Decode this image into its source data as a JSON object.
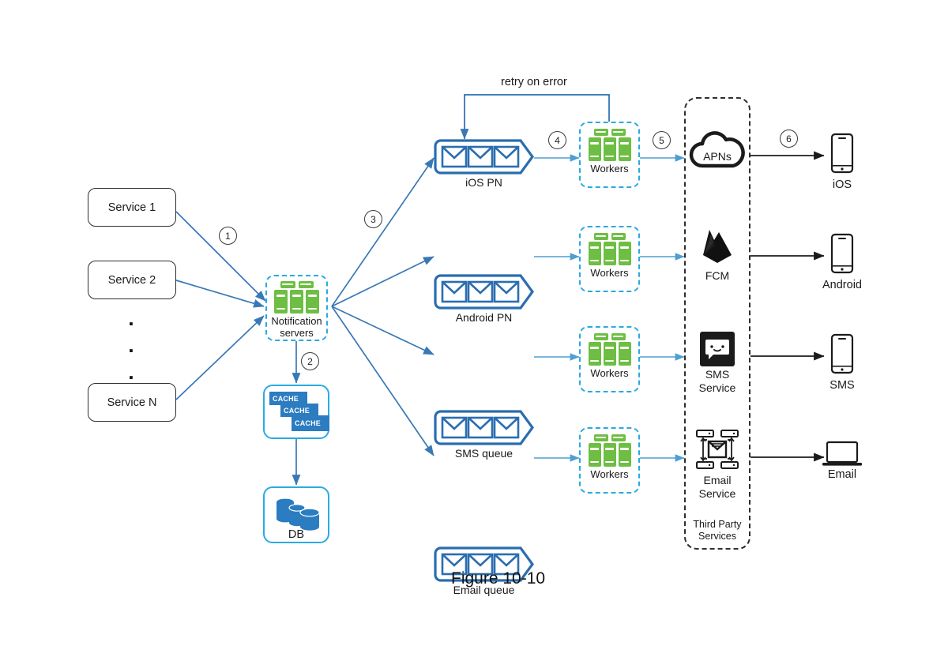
{
  "figure": {
    "caption": "Figure 10-10"
  },
  "services": {
    "items": [
      {
        "label": "Service 1"
      },
      {
        "label": "Service 2"
      },
      {
        "label": "Service N"
      }
    ],
    "ellipsis": "."
  },
  "notification_servers": {
    "line1": "Notification",
    "line2": "servers",
    "icon": "server-rack-icon"
  },
  "storage": {
    "cache": {
      "chips": [
        "CACHE",
        "CACHE",
        "CACHE"
      ],
      "icon": "cache-icon"
    },
    "db": {
      "label": "DB",
      "icon": "database-icon"
    }
  },
  "queues": [
    {
      "label": "iOS PN"
    },
    {
      "label": "Android PN"
    },
    {
      "label": "SMS queue"
    },
    {
      "label": "Email queue"
    }
  ],
  "workers": [
    {
      "label": "Workers"
    },
    {
      "label": "Workers"
    },
    {
      "label": "Workers"
    },
    {
      "label": "Workers"
    }
  ],
  "third_party": {
    "container_label_line1": "Third Party",
    "container_label_line2": "Services",
    "items": [
      {
        "name": "APNs",
        "icon": "cloud-icon",
        "label_inside": true
      },
      {
        "name": "FCM",
        "icon": "firebase-flame-icon",
        "label_inside": false
      },
      {
        "name_line1": "SMS",
        "name_line2": "Service",
        "icon": "sms-chat-icon",
        "label_inside": false
      },
      {
        "name_line1": "Email",
        "name_line2": "Service",
        "icon": "email-server-icon",
        "label_inside": false
      }
    ]
  },
  "devices": [
    {
      "label": "iOS",
      "icon": "phone-icon"
    },
    {
      "label": "Android",
      "icon": "phone-icon"
    },
    {
      "label": "SMS",
      "icon": "phone-icon"
    },
    {
      "label": "Email",
      "icon": "laptop-icon"
    }
  ],
  "steps": [
    {
      "num": "1"
    },
    {
      "num": "2"
    },
    {
      "num": "3"
    },
    {
      "num": "4"
    },
    {
      "num": "5"
    },
    {
      "num": "6"
    }
  ],
  "annotations": {
    "retry": "retry on error"
  },
  "colors": {
    "blue_line": "#3a78b5",
    "blue_dark": "#2a6db0",
    "cyan_dash": "#2aa9e0",
    "green": "#6ebe44",
    "black_line": "#1b1b1b",
    "db_blue": "#2b7cc0"
  }
}
